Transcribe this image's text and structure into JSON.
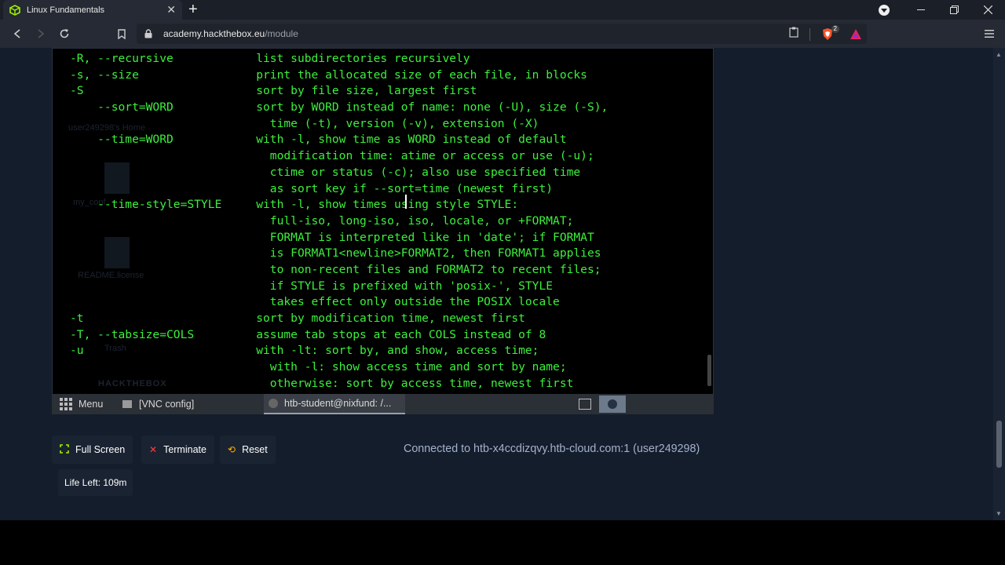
{
  "browser": {
    "tab_title": "Linux Fundamentals",
    "tab_close": "✕",
    "new_tab": "+",
    "url_host": "academy.hackthebox.eu",
    "url_path": "/module",
    "shield_badge": "2"
  },
  "terminal": {
    "lines": [
      "-R, --recursive            list subdirectories recursively",
      "-s, --size                 print the allocated size of each file, in blocks",
      "-S                         sort by file size, largest first",
      "    --sort=WORD            sort by WORD instead of name: none (-U), size (-S),",
      "                             time (-t), version (-v), extension (-X)",
      "    --time=WORD            with -l, show time as WORD instead of default",
      "                             modification time: atime or access or use (-u);",
      "                             ctime or status (-c); also use specified time",
      "                             as sort key if --sort=time (newest first)",
      "    --time-style=STYLE     with -l, show times using style STYLE:",
      "                             full-iso, long-iso, iso, locale, or +FORMAT;",
      "                             FORMAT is interpreted like in 'date'; if FORMAT",
      "                             is FORMAT1<newline>FORMAT2, then FORMAT1 applies",
      "                             to non-recent files and FORMAT2 to recent files;",
      "                             if STYLE is prefixed with 'posix-', STYLE",
      "                             takes effect only outside the POSIX locale",
      "-t                         sort by modification time, newest first",
      "-T, --tabsize=COLS         assume tab stops at each COLS instead of 8",
      "-u                         with -lt: sort by, and show, access time;",
      "                             with -l: show access time and sort by name;",
      "                             otherwise: sort by access time, newest first"
    ]
  },
  "desktop_ghost": {
    "home": "user249298's Home",
    "myconf": "my_conf",
    "readme": "README.license",
    "trash": "Trash",
    "brand": "HACKTHEBOX"
  },
  "vnc_panel": {
    "menu": "Menu",
    "vnc_config": "[VNC config]",
    "terminal_task": "htb-student@nixfund: /..."
  },
  "controls": {
    "fullscreen": "Full Screen",
    "terminate": "Terminate",
    "reset": "Reset",
    "life_left": "Life Left: 109m",
    "connected": "Connected to htb-x4ccdizqvy.htb-cloud.com:1 (user249298)"
  },
  "colors": {
    "terminal_text": "#3cf03c",
    "page_bg": "#141d2b",
    "connected_text": "#a4b1cd",
    "accent_green": "#9fef00",
    "terminate_red": "#ff3e3e",
    "reset_orange": "#ffaf00"
  }
}
